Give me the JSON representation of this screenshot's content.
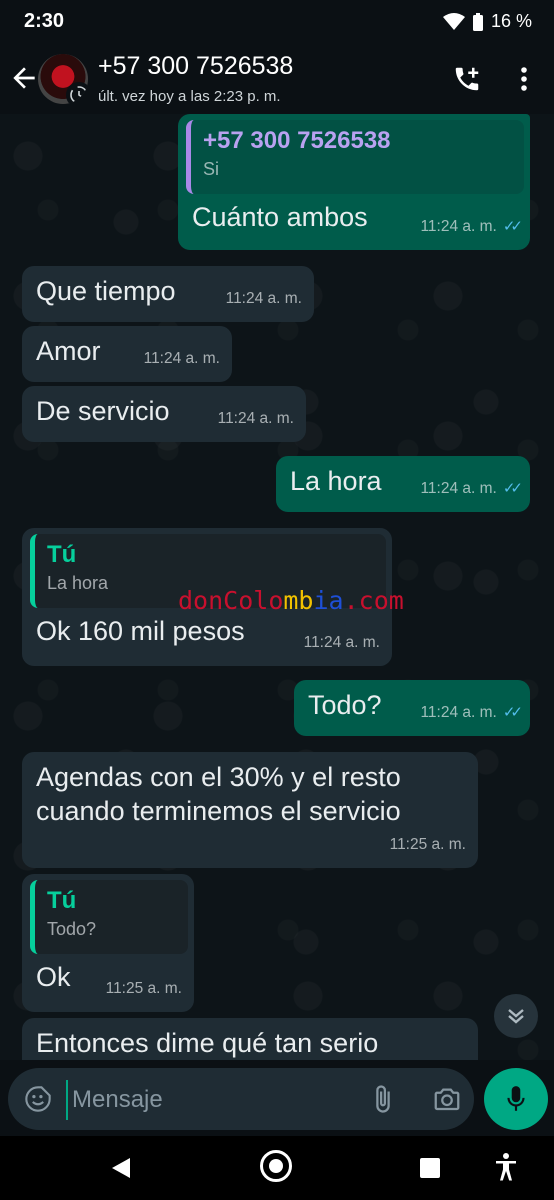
{
  "status_bar": {
    "time": "2:30",
    "battery": "16 %"
  },
  "header": {
    "contact": "+57 300 7526538",
    "last_seen": "últ. vez hoy a las 2:23 p. m."
  },
  "messages": [
    {
      "dir": "out",
      "quote_name": "+57 300 7526538",
      "quote_text": "Si",
      "text": "Cuánto ambos",
      "time": "11:24 a. m."
    },
    {
      "dir": "in",
      "text": "Que tiempo",
      "time": "11:24 a. m."
    },
    {
      "dir": "in",
      "text": "Amor",
      "time": "11:24 a. m."
    },
    {
      "dir": "in",
      "text": "De servicio",
      "time": "11:24 a. m."
    },
    {
      "dir": "out",
      "text": "La hora",
      "time": "11:24 a. m."
    },
    {
      "dir": "in",
      "quote_name": "Tú",
      "quote_text": "La hora",
      "text": "Ok 160 mil pesos",
      "time": "11:24 a. m."
    },
    {
      "dir": "out",
      "text": "Todo?",
      "time": "11:24 a. m."
    },
    {
      "dir": "in",
      "text_line1": "Agendas con el 30% y el resto",
      "text_line2": "cuando terminemos el servicio",
      "time": "11:25 a. m."
    },
    {
      "dir": "in",
      "quote_name": "Tú",
      "quote_text": "Todo?",
      "text": "Ok",
      "time": "11:25 a. m."
    },
    {
      "dir": "in",
      "text": "Entonces dime qué tan serio"
    }
  ],
  "watermark": {
    "text": "donColombia.com"
  },
  "composer": {
    "placeholder": "Mensaje"
  },
  "colors": {
    "accent": "#00a884",
    "outgoing": "#005c4b",
    "incoming": "#1f2c34",
    "read_ticks": "#53bdeb"
  },
  "icons": [
    "back-arrow-icon",
    "add-call-icon",
    "more-vert-icon",
    "sticker-icon",
    "attach-icon",
    "camera-icon",
    "mic-icon",
    "scroll-down-icon"
  ]
}
